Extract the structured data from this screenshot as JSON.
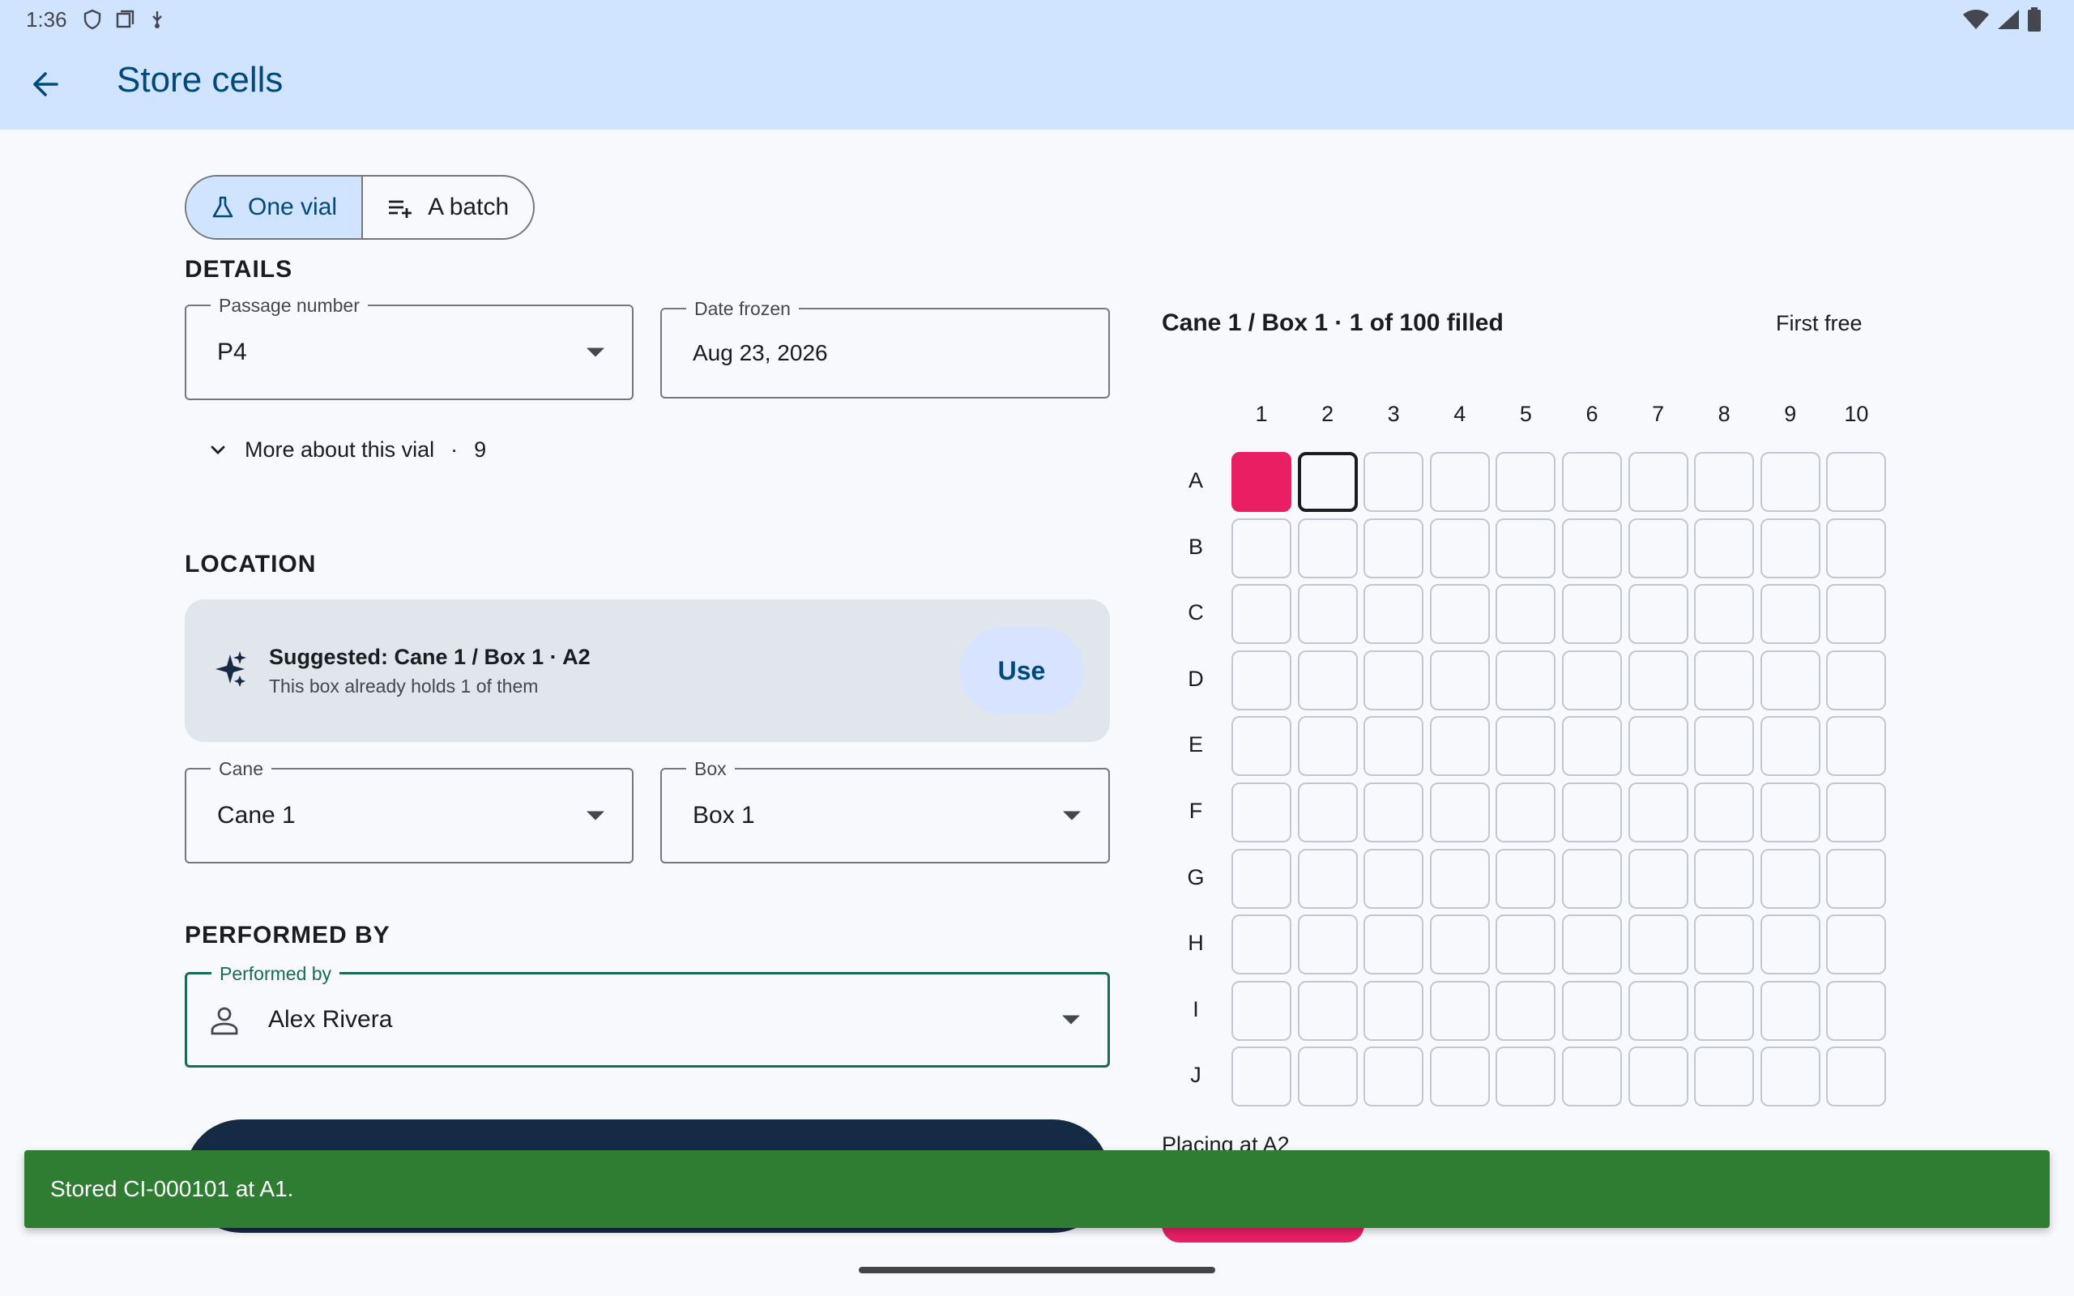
{
  "status_bar": {
    "time": "1:36"
  },
  "app_bar": {
    "title": "Store cells"
  },
  "mode_toggle": {
    "one_vial": "One vial",
    "batch": "A batch",
    "selected": "one_vial"
  },
  "details": {
    "heading": "DETAILS",
    "passage": {
      "label": "Passage number",
      "value": "P4"
    },
    "date": {
      "label": "Date frozen",
      "value": "Aug 23, 2026"
    },
    "more": {
      "label": "More about this vial",
      "separator": "·",
      "count": "9"
    }
  },
  "location": {
    "heading": "LOCATION",
    "suggestion": {
      "title": "Suggested: Cane 1 / Box 1 · A2",
      "subtitle": "This box already holds 1 of them",
      "use_label": "Use"
    },
    "cane": {
      "label": "Cane",
      "value": "Cane 1"
    },
    "box": {
      "label": "Box",
      "value": "Box 1"
    }
  },
  "performed_by": {
    "heading": "PERFORMED BY",
    "label": "Performed by",
    "value": "Alex Rivera"
  },
  "grid": {
    "title": "Cane 1 / Box 1 · 1 of 100 filled",
    "first_free": "First free",
    "columns": [
      "1",
      "2",
      "3",
      "4",
      "5",
      "6",
      "7",
      "8",
      "9",
      "10"
    ],
    "rows": [
      "A",
      "B",
      "C",
      "D",
      "E",
      "F",
      "G",
      "H",
      "I",
      "J"
    ],
    "filled": [
      "A1"
    ],
    "selected": "A2",
    "filled_color": "#e91e63",
    "placing_text": "Placing at A2"
  },
  "snackbar": {
    "message": "Stored CI-000101 at A1."
  }
}
